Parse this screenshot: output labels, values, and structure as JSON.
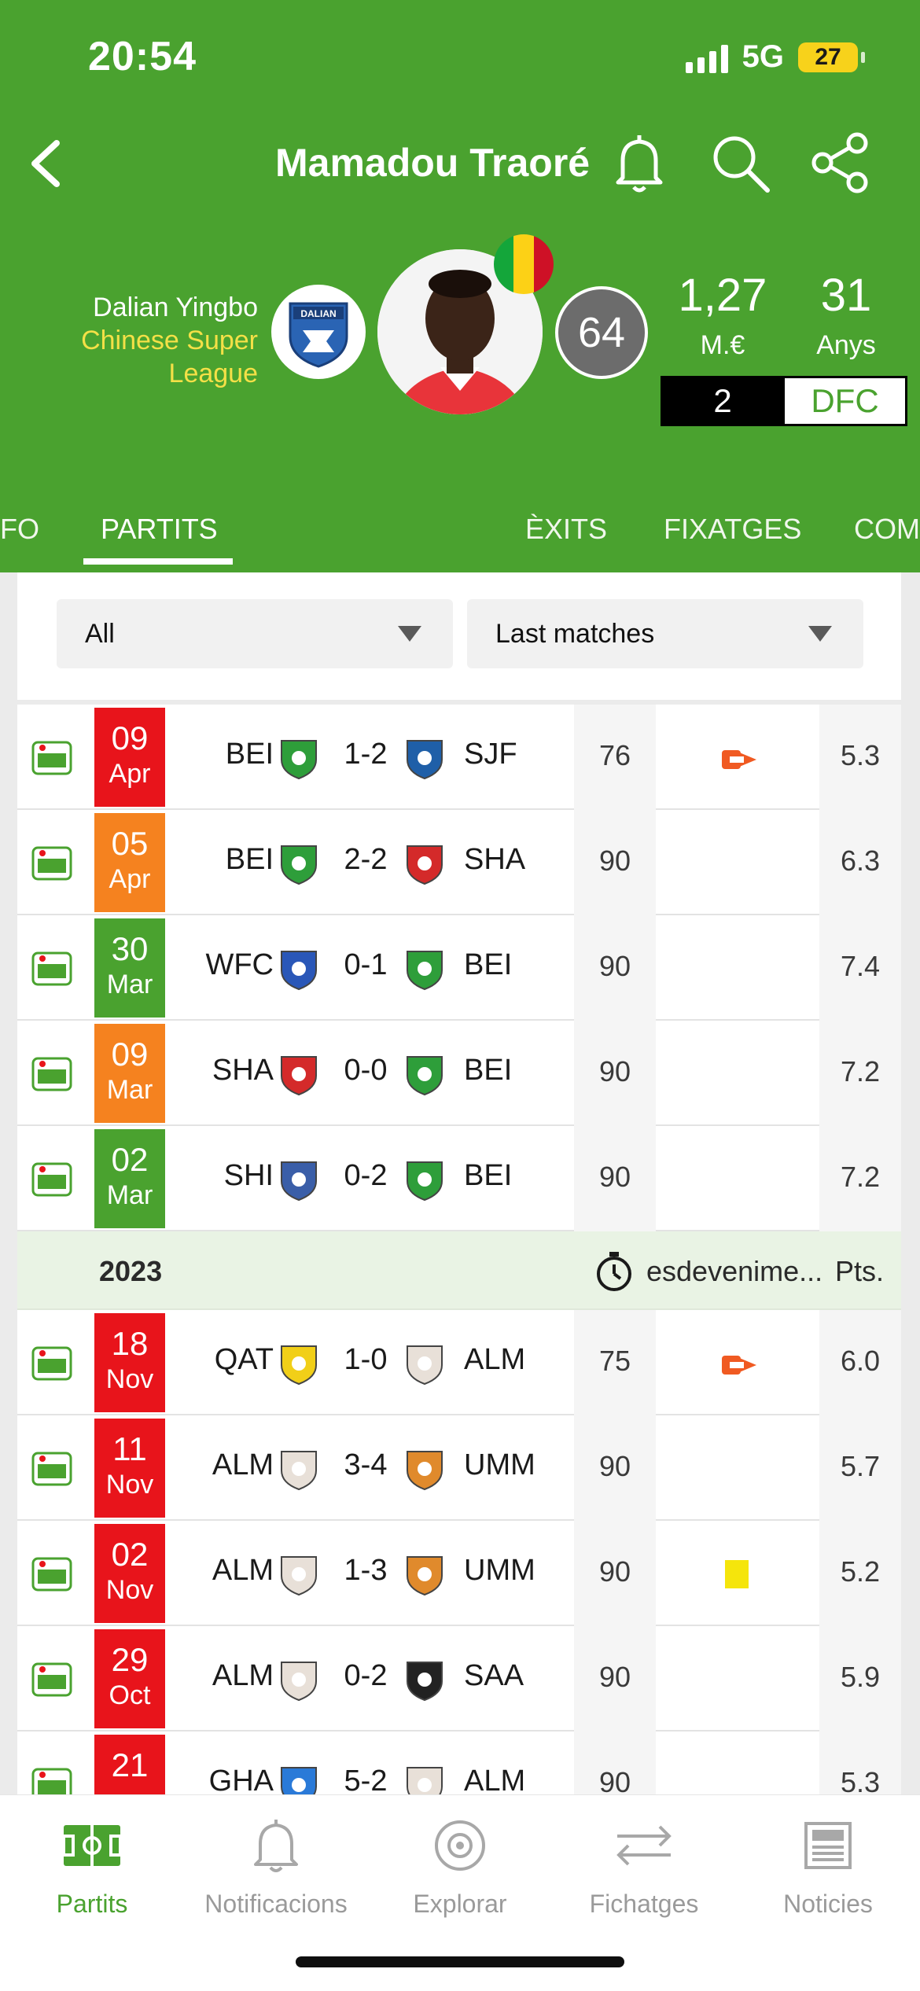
{
  "status_bar": {
    "time": "20:54",
    "network": "5G",
    "battery": "27"
  },
  "header": {
    "title": "Mamadou Traoré",
    "back_icon": "chevron-left-icon",
    "bell_icon": "bell-icon",
    "search_icon": "search-icon",
    "share_icon": "share-icon"
  },
  "player": {
    "club": "Dalian Yingbo",
    "league_line1": "Chinese Super",
    "league_line2": "League",
    "club_badge_text": "DALIAN",
    "rating": "64",
    "market_value": "1,27",
    "market_value_unit": "M.€",
    "age": "31",
    "age_unit": "Anys",
    "shirt_number": "2",
    "position": "DFC",
    "flag_colors": [
      "#14a63a",
      "#fcd116",
      "#ce1126"
    ]
  },
  "tabs": [
    {
      "label": "FO"
    },
    {
      "label": "PARTITS"
    },
    {
      "label": "ÈXITS"
    },
    {
      "label": "FIXATGES"
    },
    {
      "label": "COM"
    }
  ],
  "filters": {
    "competition": "All",
    "range": "Last matches"
  },
  "matches_2024": [
    {
      "day": "09",
      "month": "Apr",
      "result": "loss",
      "home": "BEI",
      "score": "1-2",
      "away": "SJF",
      "minutes": "76",
      "event": "sub-out",
      "rating": "5.3"
    },
    {
      "day": "05",
      "month": "Apr",
      "result": "draw",
      "home": "BEI",
      "score": "2-2",
      "away": "SHA",
      "minutes": "90",
      "event": "",
      "rating": "6.3"
    },
    {
      "day": "30",
      "month": "Mar",
      "result": "win",
      "home": "WFC",
      "score": "0-1",
      "away": "BEI",
      "minutes": "90",
      "event": "",
      "rating": "7.4"
    },
    {
      "day": "09",
      "month": "Mar",
      "result": "draw",
      "home": "SHA",
      "score": "0-0",
      "away": "BEI",
      "minutes": "90",
      "event": "",
      "rating": "7.2"
    },
    {
      "day": "02",
      "month": "Mar",
      "result": "win",
      "home": "SHI",
      "score": "0-2",
      "away": "BEI",
      "minutes": "90",
      "event": "",
      "rating": "7.2"
    }
  ],
  "season": {
    "year": "2023",
    "events_label": "esdevenime...",
    "points_label": "Pts."
  },
  "matches_2023": [
    {
      "day": "18",
      "month": "Nov",
      "result": "loss",
      "home": "QAT",
      "score": "1-0",
      "away": "ALM",
      "minutes": "75",
      "event": "sub-out",
      "rating": "6.0"
    },
    {
      "day": "11",
      "month": "Nov",
      "result": "loss",
      "home": "ALM",
      "score": "3-4",
      "away": "UMM",
      "minutes": "90",
      "event": "",
      "rating": "5.7"
    },
    {
      "day": "02",
      "month": "Nov",
      "result": "loss",
      "home": "ALM",
      "score": "1-3",
      "away": "UMM",
      "minutes": "90",
      "event": "yellow-card",
      "rating": "5.2"
    },
    {
      "day": "29",
      "month": "Oct",
      "result": "loss",
      "home": "ALM",
      "score": "0-2",
      "away": "SAA",
      "minutes": "90",
      "event": "",
      "rating": "5.9"
    },
    {
      "day": "21",
      "month": "",
      "result": "loss",
      "home": "GHA",
      "score": "5-2",
      "away": "ALM",
      "minutes": "90",
      "event": "",
      "rating": "5.3"
    }
  ],
  "result_colors": {
    "win": "#4aa22f",
    "draw": "#f5821f",
    "loss": "#e8141b"
  },
  "bottom_nav": [
    {
      "label": "Partits",
      "icon": "pitch-icon"
    },
    {
      "label": "Notificacions",
      "icon": "bell-icon"
    },
    {
      "label": "Explorar",
      "icon": "compass-icon"
    },
    {
      "label": "Fichatges",
      "icon": "transfer-arrows-icon"
    },
    {
      "label": "Noticies",
      "icon": "newspaper-icon"
    }
  ],
  "colors": {
    "brand_green": "#4aa22f",
    "league_yellow": "#f4e047",
    "sub_out": "#f05a22"
  }
}
